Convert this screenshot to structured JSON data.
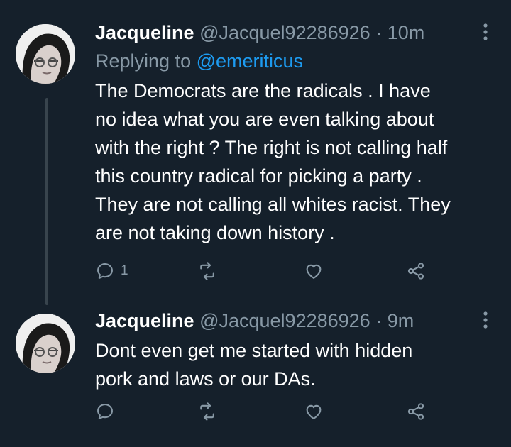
{
  "tweets": [
    {
      "name": "Jacqueline",
      "handle": "@Jacquel92286926",
      "separator": "·",
      "time": "10m",
      "replying_prefix": "Replying to ",
      "replying_to": "@emeriticus",
      "lines": [
        "The Democrats are the radicals . I have",
        "no idea what you are even talking about",
        "with the right ? The right is not calling half",
        "this country radical for picking a party .",
        "They are not calling all whites racist. They",
        "are not taking down history ."
      ],
      "reply_count": "1"
    },
    {
      "name": "Jacqueline",
      "handle": "@Jacquel92286926",
      "separator": "·",
      "time": "9m",
      "lines": [
        "Dont even get me started with hidden",
        "pork and laws or our DAs."
      ],
      "reply_count": ""
    }
  ],
  "colors": {
    "background": "#15202b",
    "text": "#ffffff",
    "secondary": "#8899a6",
    "accent": "#1d9bf0",
    "thread_line": "#38444d"
  },
  "icons": [
    "more-icon",
    "reply-icon",
    "retweet-icon",
    "like-icon",
    "share-icon"
  ]
}
